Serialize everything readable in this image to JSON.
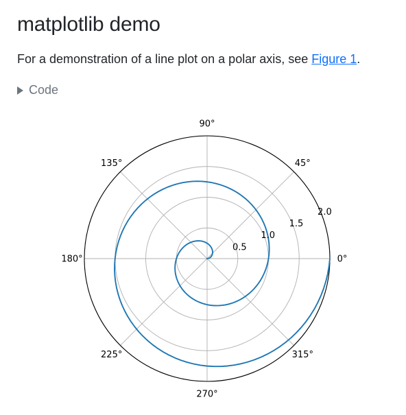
{
  "page": {
    "title": "matplotlib demo",
    "intro_before": "For a demonstration of a line plot on a polar axis, see ",
    "intro_link": "Figure 1",
    "intro_after": ".",
    "code_toggle": "Code"
  },
  "colors": {
    "line": "#1f77b4",
    "grid": "#b0b0b0",
    "link": "#0d6efd",
    "muted": "#6c757d"
  },
  "icons": {
    "code_toggle": "caret-right-icon"
  },
  "chart_data": {
    "type": "line",
    "projection": "polar",
    "title": "",
    "series": [
      {
        "r_expression": "r = 0.01 * t",
        "theta_expression": "theta = 2 * pi * r",
        "r_range": [
          0,
          2
        ],
        "step": 0.01
      }
    ],
    "rmax": 2.0,
    "r_ticks": [
      0.5,
      1.0,
      1.5,
      2.0
    ],
    "r_tick_labels": [
      "0.5",
      "1.0",
      "1.5",
      "2.0"
    ],
    "theta_ticks_deg": [
      0,
      45,
      90,
      135,
      180,
      225,
      270,
      315
    ],
    "theta_tick_labels": [
      "0°",
      "45°",
      "90°",
      "135°",
      "180°",
      "225°",
      "270°",
      "315°"
    ],
    "grid": true
  }
}
